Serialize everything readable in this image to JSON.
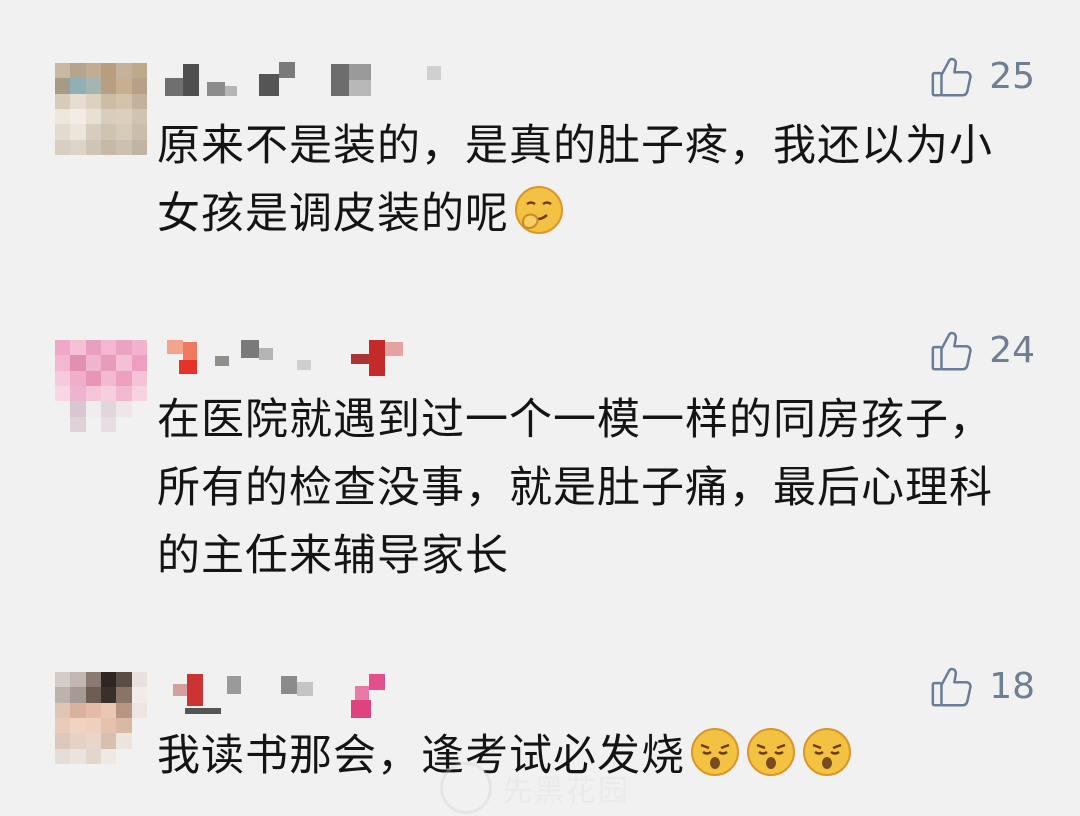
{
  "comments": [
    {
      "likes": "25",
      "text": "原来不是装的，是真的肚子疼，我还以为小女孩是调皮装的呢",
      "emojis": [
        "smirk-emoji"
      ]
    },
    {
      "likes": "24",
      "text": "在医院就遇到过一个一模一样的同房孩子，所有的检查没事，就是肚子痛，最后心理科的主任来辅导家长",
      "emojis": []
    },
    {
      "likes": "18",
      "text": "我读书那会，逢考试必发烧",
      "emojis": [
        "sleepy-emoji",
        "sleepy-emoji",
        "sleepy-emoji"
      ]
    }
  ],
  "icons": {
    "like": "thumbs-up-icon"
  },
  "colors": {
    "background": "#f1f1f1",
    "text": "#141414",
    "like": "#6b7c96"
  },
  "watermark": {
    "text": "先黑花园"
  }
}
